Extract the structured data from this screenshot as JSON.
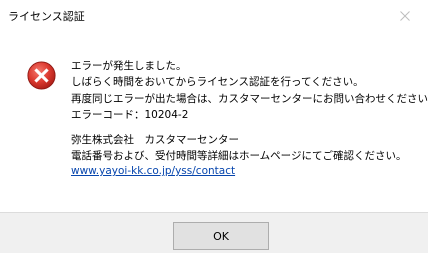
{
  "window": {
    "title": "ライセンス認証"
  },
  "icons": {
    "error": "error-icon",
    "close": "close-icon"
  },
  "colors": {
    "error_red": "#d9302c",
    "link": "#0645ad",
    "footer_bg": "#f0f0f0",
    "button_bg": "#e1e1e1"
  },
  "message": {
    "lines": [
      "エラーが発生しました。",
      "しばらく時間をおいてからライセンス認証を行ってください。",
      "再度同じエラーが出た場合は、カスタマーセンターにお問い合わせください。",
      "エラーコード：10204-2"
    ]
  },
  "contact": {
    "company": "弥生株式会社　カスタマーセンター",
    "note": "電話番号および、受付時間等詳細はホームページにてご確認ください。",
    "link_text": "www.yayoi-kk.co.jp/yss/contact"
  },
  "buttons": {
    "ok_label": "OK"
  }
}
